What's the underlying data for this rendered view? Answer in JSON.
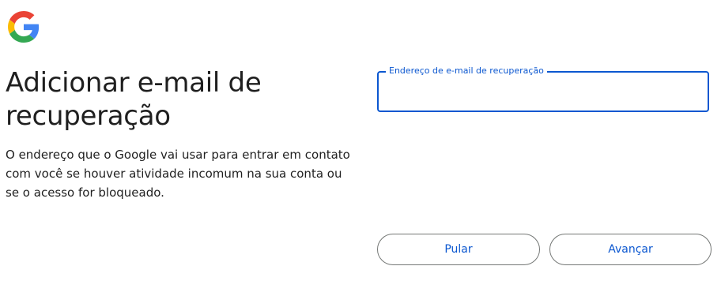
{
  "brand": {
    "logo_icon": "google-g-logo",
    "colors": {
      "blue": "#4285F4",
      "red": "#EA4335",
      "yellow": "#FBBC05",
      "green": "#34A853",
      "accent": "#0b57d0"
    }
  },
  "header": {
    "title": "Adicionar e-mail de recuperação",
    "description": "O endereço que o Google vai usar para entrar em contato com você se houver atividade incomum na sua conta ou se o acesso for bloqueado."
  },
  "form": {
    "recovery_email": {
      "label": "Endereço de e-mail de recuperação",
      "value": ""
    }
  },
  "actions": {
    "skip_label": "Pular",
    "next_label": "Avançar"
  }
}
